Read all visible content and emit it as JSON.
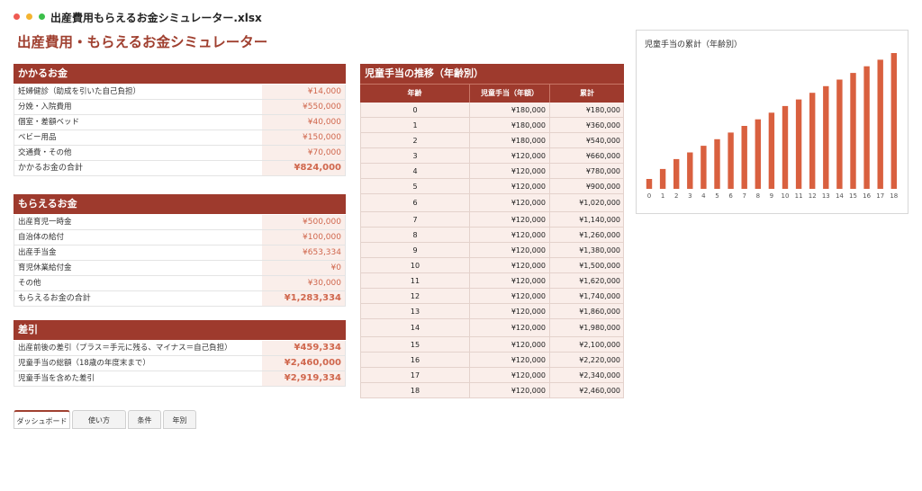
{
  "window": {
    "title": "出産費用もらえるお金シミュレーター.xlsx"
  },
  "page_title": "出産費用・もらえるお金シミュレーター",
  "costs": {
    "header": "かかるお金",
    "rows": [
      {
        "label": "妊婦健診（助成を引いた自己負担）",
        "value": "¥14,000"
      },
      {
        "label": "分娩・入院費用",
        "value": "¥550,000"
      },
      {
        "label": "個室・差額ベッド",
        "value": "¥40,000"
      },
      {
        "label": "ベビー用品",
        "value": "¥150,000"
      },
      {
        "label": "交通費・その他",
        "value": "¥70,000"
      }
    ],
    "total_label": "かかるお金の合計",
    "total_value": "¥824,000"
  },
  "income": {
    "header": "もらえるお金",
    "rows": [
      {
        "label": "出産育児一時金",
        "value": "¥500,000"
      },
      {
        "label": "自治体の給付",
        "value": "¥100,000"
      },
      {
        "label": "出産手当金",
        "value": "¥653,334"
      },
      {
        "label": "育児休業給付金",
        "value": "¥0"
      },
      {
        "label": "その他",
        "value": "¥30,000"
      }
    ],
    "total_label": "もらえるお金の合計",
    "total_value": "¥1,283,334"
  },
  "difference": {
    "header": "差引",
    "rows": [
      {
        "label": "出産前後の差引（プラス＝手元に残る、マイナス＝自己負担）",
        "value": "¥459,334"
      },
      {
        "label": "児童手当の総額（18歳の年度末まで）",
        "value": "¥2,460,000"
      },
      {
        "label": "児童手当を含めた差引",
        "value": "¥2,919,334"
      }
    ]
  },
  "allowance_table": {
    "header": "児童手当の推移（年齢別）",
    "columns": [
      "年齢",
      "児童手当（年額）",
      "累計"
    ],
    "rows": [
      {
        "age": "0",
        "annual": "¥180,000",
        "cumulative": "¥180,000"
      },
      {
        "age": "1",
        "annual": "¥180,000",
        "cumulative": "¥360,000"
      },
      {
        "age": "2",
        "annual": "¥180,000",
        "cumulative": "¥540,000"
      },
      {
        "age": "3",
        "annual": "¥120,000",
        "cumulative": "¥660,000"
      },
      {
        "age": "4",
        "annual": "¥120,000",
        "cumulative": "¥780,000"
      },
      {
        "age": "5",
        "annual": "¥120,000",
        "cumulative": "¥900,000"
      },
      {
        "age": "6",
        "annual": "¥120,000",
        "cumulative": "¥1,020,000"
      },
      {
        "age": "7",
        "annual": "¥120,000",
        "cumulative": "¥1,140,000"
      },
      {
        "age": "8",
        "annual": "¥120,000",
        "cumulative": "¥1,260,000"
      },
      {
        "age": "9",
        "annual": "¥120,000",
        "cumulative": "¥1,380,000"
      },
      {
        "age": "10",
        "annual": "¥120,000",
        "cumulative": "¥1,500,000"
      },
      {
        "age": "11",
        "annual": "¥120,000",
        "cumulative": "¥1,620,000"
      },
      {
        "age": "12",
        "annual": "¥120,000",
        "cumulative": "¥1,740,000"
      },
      {
        "age": "13",
        "annual": "¥120,000",
        "cumulative": "¥1,860,000"
      },
      {
        "age": "14",
        "annual": "¥120,000",
        "cumulative": "¥1,980,000"
      },
      {
        "age": "15",
        "annual": "¥120,000",
        "cumulative": "¥2,100,000"
      },
      {
        "age": "16",
        "annual": "¥120,000",
        "cumulative": "¥2,220,000"
      },
      {
        "age": "17",
        "annual": "¥120,000",
        "cumulative": "¥2,340,000"
      },
      {
        "age": "18",
        "annual": "¥120,000",
        "cumulative": "¥2,460,000"
      }
    ]
  },
  "chart_data": {
    "type": "bar",
    "title": "児童手当の累計（年齢別）",
    "categories": [
      "0",
      "1",
      "2",
      "3",
      "4",
      "5",
      "6",
      "7",
      "8",
      "9",
      "10",
      "11",
      "12",
      "13",
      "14",
      "15",
      "16",
      "17",
      "18"
    ],
    "values": [
      180000,
      360000,
      540000,
      660000,
      780000,
      900000,
      1020000,
      1140000,
      1260000,
      1380000,
      1500000,
      1620000,
      1740000,
      1860000,
      1980000,
      2100000,
      2220000,
      2340000,
      2460000
    ],
    "xlabel": "",
    "ylabel": "",
    "ylim": [
      0,
      2460000
    ],
    "grid": false,
    "legend": "none",
    "bar_color": "#d9603f"
  },
  "sheet_tabs": [
    {
      "label": "ダッシュボード",
      "active": true
    },
    {
      "label": "使い方",
      "active": false
    },
    {
      "label": "条件",
      "active": false
    },
    {
      "label": "年別",
      "active": false
    }
  ],
  "colors": {
    "header_bg": "#9e3a2d",
    "value_bg": "#faeeea",
    "value_text": "#d0674d",
    "title_text": "#a04030"
  }
}
